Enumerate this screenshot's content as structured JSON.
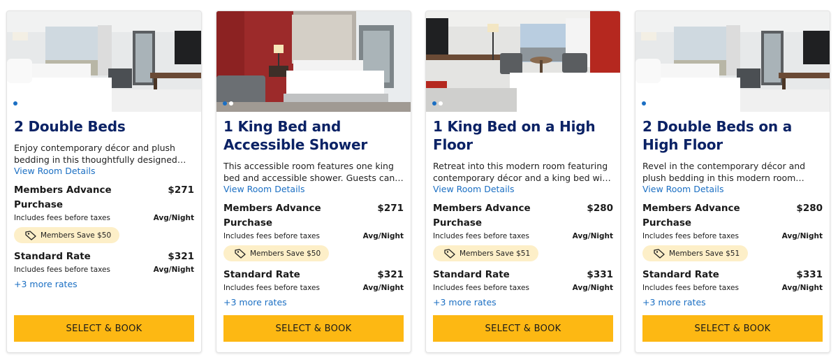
{
  "cards": [
    {
      "title": "2 Double Beds",
      "description": "Enjoy contemporary décor and plush bedding in this thoughtfully designed room with two…",
      "details_link": "View Room Details",
      "rates": [
        {
          "name": "Members Advance Purchase",
          "price": "$271",
          "fees": "Includes fees before taxes",
          "per": "Avg/Night",
          "badge": "Members Save $50"
        },
        {
          "name": "Standard Rate",
          "price": "$321",
          "fees": "Includes fees before taxes",
          "per": "Avg/Night"
        }
      ],
      "more_rates": "+3 more rates",
      "book_label": "SELECT & BOOK"
    },
    {
      "title": "1 King Bed and Accessible Shower",
      "description": "This accessible room features one king bed and accessible shower. Guests can also enjoy…",
      "details_link": "View Room Details",
      "rates": [
        {
          "name": "Members Advance Purchase",
          "price": "$271",
          "fees": "Includes fees before taxes",
          "per": "Avg/Night",
          "badge": "Members Save $50"
        },
        {
          "name": "Standard Rate",
          "price": "$321",
          "fees": "Includes fees before taxes",
          "per": "Avg/Night"
        }
      ],
      "more_rates": "+3 more rates",
      "book_label": "SELECT & BOOK"
    },
    {
      "title": "1 King Bed on a High Floor",
      "description": "Retreat into this modern room featuring contemporary décor and a king bed with plu…",
      "details_link": "View Room Details",
      "rates": [
        {
          "name": "Members Advance Purchase",
          "price": "$280",
          "fees": "Includes fees before taxes",
          "per": "Avg/Night",
          "badge": "Members Save $51"
        },
        {
          "name": "Standard Rate",
          "price": "$331",
          "fees": "Includes fees before taxes",
          "per": "Avg/Night"
        }
      ],
      "more_rates": "+3 more rates",
      "book_label": "SELECT & BOOK"
    },
    {
      "title": "2 Double Beds on a High Floor",
      "description": "Revel in the contemporary décor and plush bedding in this modern room furnished with…",
      "details_link": "View Room Details",
      "rates": [
        {
          "name": "Members Advance Purchase",
          "price": "$280",
          "fees": "Includes fees before taxes",
          "per": "Avg/Night",
          "badge": "Members Save $51"
        },
        {
          "name": "Standard Rate",
          "price": "$331",
          "fees": "Includes fees before taxes",
          "per": "Avg/Night"
        }
      ],
      "more_rates": "+3 more rates",
      "book_label": "SELECT & BOOK"
    }
  ],
  "icons": {
    "badge": "tag-icon"
  },
  "colors": {
    "title": "#0b2265",
    "link": "#1b6fc3",
    "button": "#fdb813",
    "badge_bg": "#fdefc8",
    "dot_active": "#1b6fc3"
  }
}
